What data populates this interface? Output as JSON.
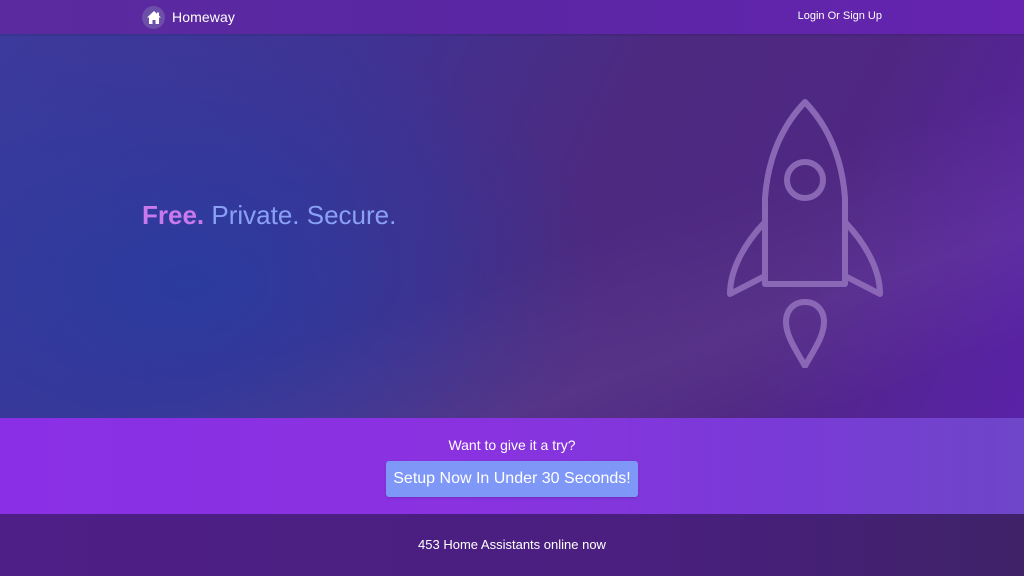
{
  "navbar": {
    "brand_name": "Homeway",
    "logo_icon": "home-icon",
    "login_label": "Login Or Sign Up"
  },
  "hero": {
    "headline_free": "Free.",
    "headline_rest": "Private. Secure.",
    "illustration_icon": "rocket-icon"
  },
  "cta": {
    "prompt": "Want to give it a try?",
    "button_label": "Setup Now In Under 30 Seconds!"
  },
  "status": {
    "online_text": "453 Home Assistants online now"
  },
  "colors": {
    "nav_bg": "#5a26a4",
    "headline_accent": "#c879ec",
    "headline_text": "#8aa0f5",
    "cta_bg": "#8a2fe6",
    "button_bg": "#7f97f7",
    "status_bg": "#4e1f86"
  }
}
